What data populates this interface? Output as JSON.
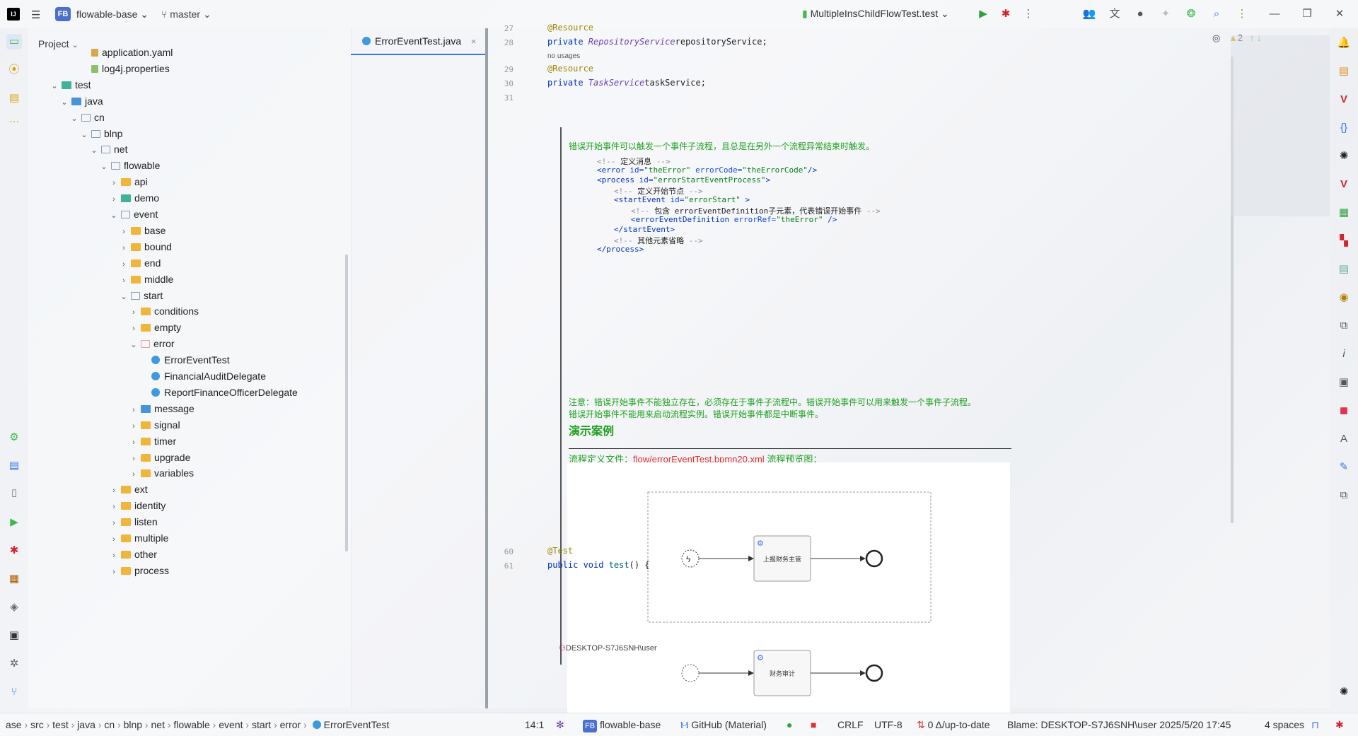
{
  "titlebar": {
    "logo": "IJ",
    "project_badge": "FB",
    "project_name": "flowable-base",
    "branch": "master",
    "run_config": "MultipleInsChildFlowTest.test"
  },
  "project_panel": {
    "title": "Project",
    "tree": [
      {
        "label": "application.yaml",
        "indent": 5,
        "icon": "yaml",
        "chev": ""
      },
      {
        "label": "log4j.properties",
        "indent": 5,
        "icon": "props",
        "chev": ""
      },
      {
        "label": "test",
        "indent": 2,
        "icon": "test",
        "chev": "v"
      },
      {
        "label": "java",
        "indent": 3,
        "icon": "src",
        "chev": "v"
      },
      {
        "label": "cn",
        "indent": 4,
        "icon": "pkg",
        "chev": "v"
      },
      {
        "label": "blnp",
        "indent": 5,
        "icon": "pkg",
        "chev": "v"
      },
      {
        "label": "net",
        "indent": 6,
        "icon": "pkg",
        "chev": "v"
      },
      {
        "label": "flowable",
        "indent": 7,
        "icon": "pkg",
        "chev": "v"
      },
      {
        "label": "api",
        "indent": 8,
        "icon": "fold",
        "chev": ">"
      },
      {
        "label": "demo",
        "indent": 8,
        "icon": "test",
        "chev": ">"
      },
      {
        "label": "event",
        "indent": 8,
        "icon": "pkg",
        "chev": "v"
      },
      {
        "label": "base",
        "indent": 9,
        "icon": "fold",
        "chev": ">"
      },
      {
        "label": "bound",
        "indent": 9,
        "icon": "fold",
        "chev": ">"
      },
      {
        "label": "end",
        "indent": 9,
        "icon": "fold",
        "chev": ">"
      },
      {
        "label": "middle",
        "indent": 9,
        "icon": "fold",
        "chev": ">"
      },
      {
        "label": "start",
        "indent": 9,
        "icon": "pkg",
        "chev": "v"
      },
      {
        "label": "conditions",
        "indent": 10,
        "icon": "fold",
        "chev": ">"
      },
      {
        "label": "empty",
        "indent": 10,
        "icon": "fold",
        "chev": ">"
      },
      {
        "label": "error",
        "indent": 10,
        "icon": "open",
        "chev": "v"
      },
      {
        "label": "ErrorEventTest",
        "indent": 11,
        "icon": "java",
        "chev": ""
      },
      {
        "label": "FinancialAuditDelegate",
        "indent": 11,
        "icon": "java",
        "chev": ""
      },
      {
        "label": "ReportFinanceOfficerDelegate",
        "indent": 11,
        "icon": "java",
        "chev": ""
      },
      {
        "label": "message",
        "indent": 10,
        "icon": "src",
        "chev": ">"
      },
      {
        "label": "signal",
        "indent": 10,
        "icon": "fold",
        "chev": ">"
      },
      {
        "label": "timer",
        "indent": 10,
        "icon": "fold",
        "chev": ">"
      },
      {
        "label": "upgrade",
        "indent": 10,
        "icon": "fold",
        "chev": ">"
      },
      {
        "label": "variables",
        "indent": 10,
        "icon": "fold",
        "chev": ">"
      },
      {
        "label": "ext",
        "indent": 8,
        "icon": "fold",
        "chev": ">"
      },
      {
        "label": "identity",
        "indent": 8,
        "icon": "fold",
        "chev": ">"
      },
      {
        "label": "listen",
        "indent": 8,
        "icon": "fold",
        "chev": ">"
      },
      {
        "label": "multiple",
        "indent": 8,
        "icon": "fold",
        "chev": ">"
      },
      {
        "label": "other",
        "indent": 8,
        "icon": "fold",
        "chev": ">"
      },
      {
        "label": "process",
        "indent": 8,
        "icon": "fold",
        "chev": ">"
      }
    ]
  },
  "editor_tab": {
    "label": "ErrorEventTest.java",
    "close": "×"
  },
  "editor": {
    "inspections_count": "2",
    "lines": [
      {
        "num": "27",
        "parts": [
          [
            "ann",
            "@Resource"
          ]
        ]
      },
      {
        "num": "28",
        "parts": [
          [
            "kw",
            "private "
          ],
          [
            "ty",
            "RepositoryService"
          ],
          [
            "",
            "repositoryService;"
          ]
        ]
      },
      {
        "num": "",
        "parts": [
          [
            "",
            "no usages"
          ]
        ]
      },
      {
        "num": "29",
        "parts": [
          [
            "ann",
            "@Resource"
          ]
        ]
      },
      {
        "num": "30",
        "parts": [
          [
            "kw",
            "private "
          ],
          [
            "ty",
            "TaskService"
          ],
          [
            "",
            "taskService;"
          ]
        ]
      },
      {
        "num": "31",
        "parts": []
      }
    ],
    "doc": {
      "intro": "错误开始事件可以触发一个事件子流程，且总是在另外一个流程异常结束时触发。",
      "xml": [
        {
          "indent": 0,
          "parts": [
            [
              "xcom",
              "<!-- "
            ],
            [
              "",
              "定义消息 "
            ],
            [
              "xcom",
              "-->"
            ]
          ]
        },
        {
          "indent": 0,
          "parts": [
            [
              "xtag",
              "<error "
            ],
            [
              "xatt",
              "id="
            ],
            [
              "xval",
              "\"theError\" "
            ],
            [
              "xatt",
              "errorCode="
            ],
            [
              "xval",
              "\"theErrorCode\""
            ],
            [
              "xtag",
              "/>"
            ]
          ]
        },
        {
          "indent": 0,
          "parts": [
            [
              "xtag",
              "<process "
            ],
            [
              "xatt",
              "id="
            ],
            [
              "xval",
              "\"errorStartEventProcess\""
            ],
            [
              "xtag",
              ">"
            ]
          ]
        },
        {
          "indent": 1,
          "parts": [
            [
              "xcom",
              "<!-- "
            ],
            [
              "",
              "定义开始节点 "
            ],
            [
              "xcom",
              "-->"
            ]
          ]
        },
        {
          "indent": 1,
          "parts": [
            [
              "xtag",
              "<startEvent "
            ],
            [
              "xatt",
              "id="
            ],
            [
              "xval",
              "\"errorStart\" "
            ],
            [
              "xtag",
              ">"
            ]
          ]
        },
        {
          "indent": 2,
          "parts": [
            [
              "xcom",
              "<!-- "
            ],
            [
              "",
              "包含 errorEventDefinition子元素，代表错误开始事件 "
            ],
            [
              "xcom",
              "-->"
            ]
          ]
        },
        {
          "indent": 2,
          "parts": [
            [
              "xtag",
              "<errorEventDefinition "
            ],
            [
              "xatt",
              "errorRef="
            ],
            [
              "xval",
              "\"theError\" "
            ],
            [
              "xtag",
              "/>"
            ]
          ]
        },
        {
          "indent": 1,
          "parts": [
            [
              "xtag",
              "</startEvent>"
            ]
          ]
        },
        {
          "indent": 1,
          "parts": [
            [
              "xcom",
              "<!-- "
            ],
            [
              "",
              "其他元素省略 "
            ],
            [
              "xcom",
              "-->"
            ]
          ]
        },
        {
          "indent": 0,
          "parts": [
            [
              "xtag",
              "</process>"
            ]
          ]
        }
      ],
      "note1": "注意：错误开始事件不能独立存在，必须存在于事件子流程中。错误开始事件可以用来触发一个事件子流程。",
      "note2": "错误开始事件不能用来启动流程实例。错误开始事件都是中断事件。",
      "heading": "演示案例",
      "file_prefix": "流程定义文件：",
      "file_link": "flow/errorEventTest.bpmn20.xml",
      "file_suffix": " 流程预览图：",
      "task1": "上报财务主管",
      "task2": "财务审计"
    },
    "author": "DESKTOP-S7J6SNH\\user",
    "tail_lines": [
      {
        "num": "60",
        "parts": [
          [
            "ann",
            "@Test"
          ]
        ]
      },
      {
        "num": "61",
        "parts": [
          [
            "kw",
            "public void "
          ],
          [
            "fn",
            "test"
          ],
          [
            "",
            "() {"
          ]
        ]
      }
    ]
  },
  "statusbar": {
    "breadcrumb": [
      "ase",
      "src",
      "test",
      "java",
      "cn",
      "blnp",
      "net",
      "flowable",
      "event",
      "start",
      "error",
      "ErrorEventTest"
    ],
    "position": "14:1",
    "project_badge": "FB",
    "project": "flowable-base",
    "theme": "GitHub (Material)",
    "line_sep": "CRLF",
    "encoding": "UTF-8",
    "vcs": "0 Δ/up-to-date",
    "blame": "Blame: DESKTOP-S7J6SNH\\user 2025/5/20 17:45",
    "indent": "4 spaces"
  }
}
